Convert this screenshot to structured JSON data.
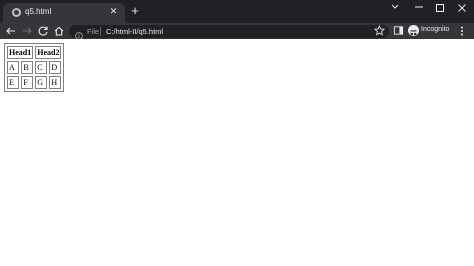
{
  "browser": {
    "tab": {
      "title": "q5.html",
      "favicon": "globe-icon"
    },
    "new_tab_label": "+",
    "window_controls": [
      "chevron-down-icon",
      "minimize-icon",
      "maximize-icon",
      "close-icon"
    ],
    "address": {
      "scheme_label": "File",
      "url": "C:/html-II/q5.html"
    },
    "profile_label": "Incognito"
  },
  "page": {
    "table": {
      "headers": [
        "Head1",
        "Head2"
      ],
      "rows": [
        [
          "A",
          "B",
          "C",
          "D"
        ],
        [
          "E",
          "F",
          "G",
          "H"
        ]
      ]
    }
  },
  "colors": {
    "tabstrip": "#202124",
    "toolbar": "#35363a",
    "omnibox": "#202124",
    "text_light": "#e8eaed"
  }
}
